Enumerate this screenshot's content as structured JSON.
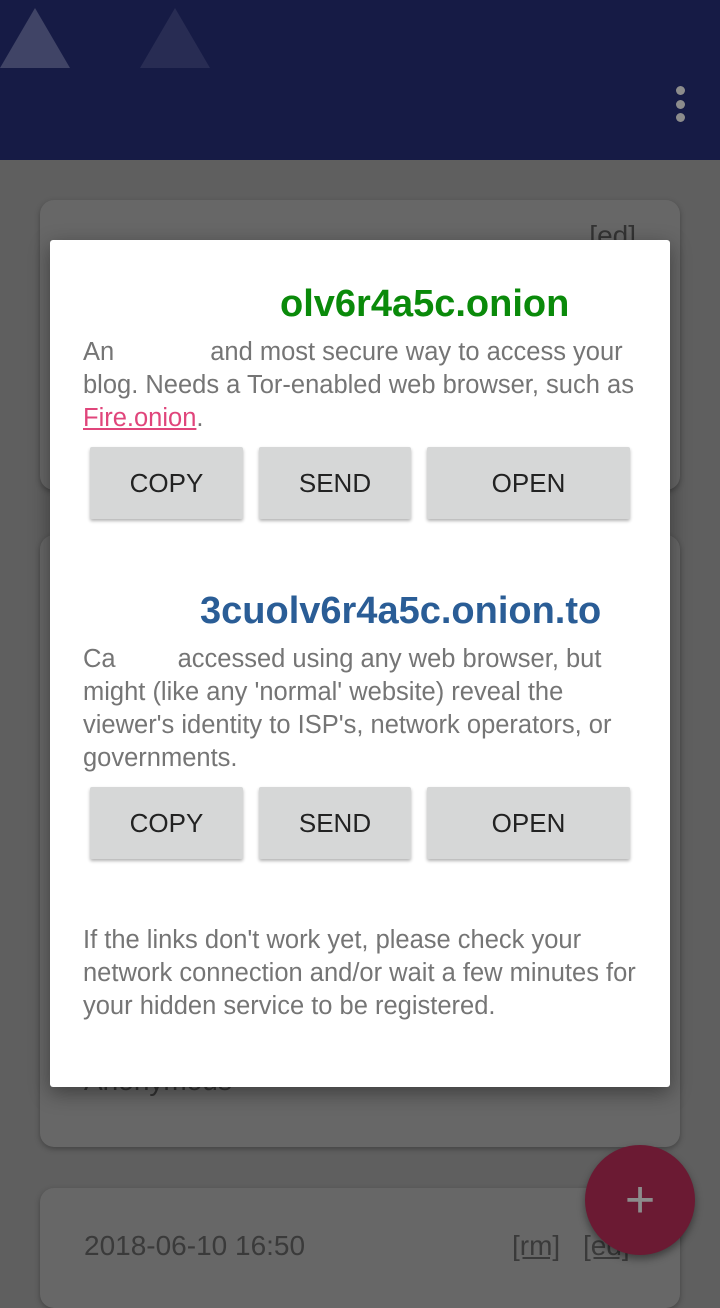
{
  "appbar": {
    "menu_icon": "more-vert-icon",
    "background": "#161b45"
  },
  "cards": [
    {
      "edit": "[ed]"
    },
    {
      "author": "Anonymous"
    },
    {
      "date": "2018-06-10 16:50",
      "remove": "[rm]",
      "edit": "[ed]"
    }
  ],
  "dialog": {
    "onion": {
      "address": "olv6r4a5c.onion",
      "desc_pre": "An",
      "desc_main": "and most secure way to access your blog. Needs a Tor-enabled web browser, such as ",
      "link": "Fire.onion",
      "desc_post": ".",
      "color": "#0a8a0a",
      "buttons": [
        "COPY",
        "SEND",
        "OPEN"
      ]
    },
    "clearnet": {
      "address": "3cuolv6r4a5c.onion.to",
      "desc_pre": "Ca",
      "desc_main": "accessed using any web browser, but might (like any 'normal' website) reveal the viewer's identity to ISP's, network operators, or governments.",
      "color": "#2a5d96",
      "buttons": [
        "COPY",
        "SEND",
        "OPEN"
      ]
    },
    "note": "If the links don't work yet, please check your network connection and/or wait a few minutes for your hidden service to be registered."
  },
  "fab": {
    "label": "+",
    "icon": "add-icon",
    "color": "#6b1a33"
  }
}
